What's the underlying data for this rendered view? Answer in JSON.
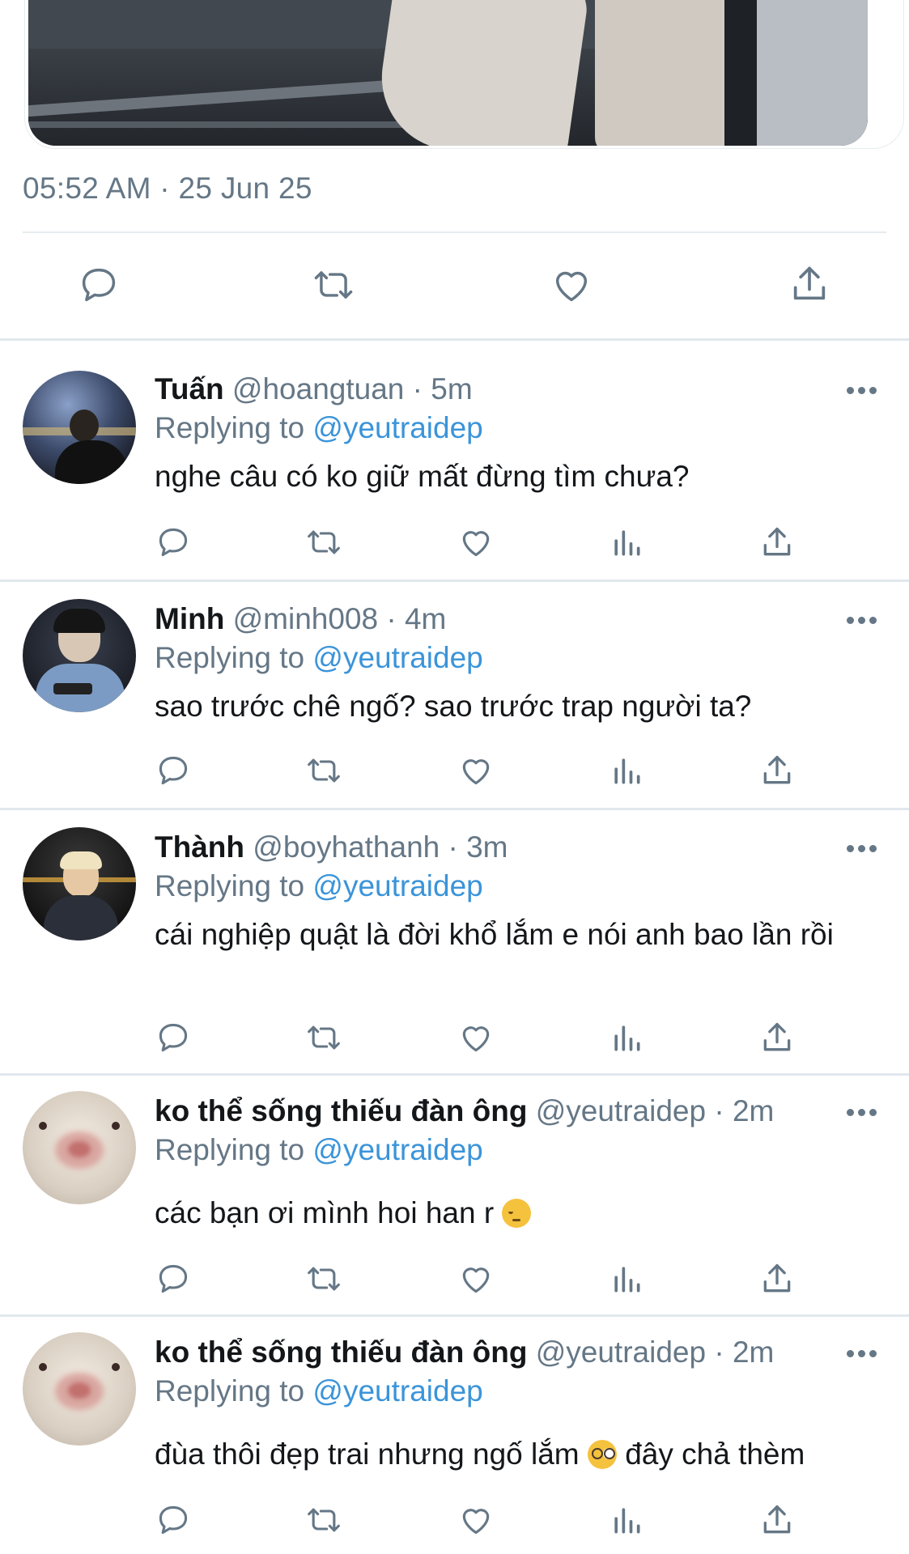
{
  "tweet": {
    "timestamp": "05:52 AM · 25 Jun 25"
  },
  "main_actions": [
    "reply-icon",
    "retweet-icon",
    "like-icon",
    "share-icon"
  ],
  "reply_actions": [
    "reply-icon",
    "retweet-icon",
    "like-icon",
    "analytics-icon",
    "share-icon"
  ],
  "replies": [
    {
      "name": "Tuấn",
      "handle": "@hoangtuan · 5m",
      "replying_prefix": "Replying to ",
      "replying_to": "@yeutraidep",
      "text": "nghe câu có ko giữ mất đừng tìm chưa?"
    },
    {
      "name": "Minh",
      "handle": "@minh008 · 4m",
      "replying_prefix": "Replying to ",
      "replying_to": "@yeutraidep",
      "text": "sao trước chê ngố? sao trước trap người ta?"
    },
    {
      "name": "Thành",
      "handle": "@boyhathanh · 3m",
      "replying_prefix": "Replying to ",
      "replying_to": "@yeutraidep",
      "text": "cái nghiệp quật là đời khổ lắm e nói anh bao lần rồi"
    },
    {
      "name": "ko thể sống thiếu đàn ông",
      "handle": "@yeutraidep · 2m",
      "replying_prefix": "Replying to ",
      "replying_to": "@yeutraidep",
      "text": "các bạn ơi mình hoi han r",
      "emoji": "pensive-face"
    },
    {
      "name": "ko thể sống thiếu đàn ông",
      "handle": "@yeutraidep · 2m",
      "replying_prefix": "Replying to ",
      "replying_to": "@yeutraidep",
      "text_before": "đùa thôi đẹp trai nhưng ngố lắm",
      "text_after": "đây chả thèm",
      "emoji": "nerd-face"
    }
  ],
  "colors": {
    "text": "#14171a",
    "secondary": "#657786",
    "link": "#3b94d9",
    "divider": "#e6ecf0"
  }
}
